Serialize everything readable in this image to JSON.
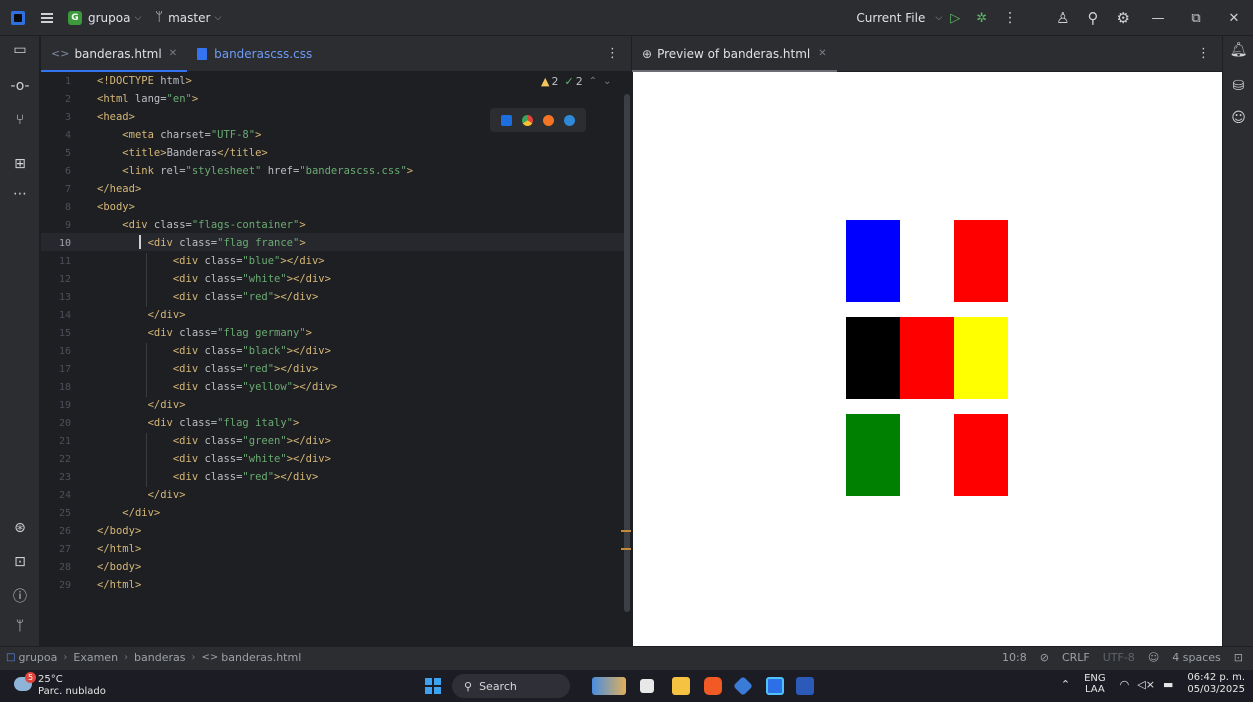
{
  "titlebar": {
    "project_badge": "G",
    "project_name": "grupoa",
    "branch_name": "master",
    "run_config": "Current File"
  },
  "editor_tabs": [
    {
      "label": "banderas.html",
      "active": true
    },
    {
      "label": "banderascss.css",
      "active": false
    }
  ],
  "editor": {
    "warnings_count": "2",
    "ok_count": "2",
    "current_line": "10",
    "lines": [
      {
        "num": "1",
        "text": "<!DOCTYPE html>"
      },
      {
        "num": "2",
        "text": "<html lang=\"en\">"
      },
      {
        "num": "3",
        "text": "<head>"
      },
      {
        "num": "4",
        "text": "    <meta charset=\"UTF-8\">"
      },
      {
        "num": "5",
        "text": "    <title>Banderas</title>"
      },
      {
        "num": "6",
        "text": "    <link rel=\"stylesheet\" href=\"banderascss.css\">"
      },
      {
        "num": "7",
        "text": "</head>"
      },
      {
        "num": "8",
        "text": "<body>"
      },
      {
        "num": "9",
        "text": "    <div class=\"flags-container\">"
      },
      {
        "num": "10",
        "text": "        <div class=\"flag france\">"
      },
      {
        "num": "11",
        "text": "            <div class=\"blue\"></div>"
      },
      {
        "num": "12",
        "text": "            <div class=\"white\"></div>"
      },
      {
        "num": "13",
        "text": "            <div class=\"red\"></div>"
      },
      {
        "num": "14",
        "text": "        </div>"
      },
      {
        "num": "15",
        "text": "        <div class=\"flag germany\">"
      },
      {
        "num": "16",
        "text": "            <div class=\"black\"></div>"
      },
      {
        "num": "17",
        "text": "            <div class=\"red\"></div>"
      },
      {
        "num": "18",
        "text": "            <div class=\"yellow\"></div>"
      },
      {
        "num": "19",
        "text": "        </div>"
      },
      {
        "num": "20",
        "text": "        <div class=\"flag italy\">"
      },
      {
        "num": "21",
        "text": "            <div class=\"green\"></div>"
      },
      {
        "num": "22",
        "text": "            <div class=\"white\"></div>"
      },
      {
        "num": "23",
        "text": "            <div class=\"red\"></div>"
      },
      {
        "num": "24",
        "text": "        </div>"
      },
      {
        "num": "25",
        "text": "    </div>"
      },
      {
        "num": "26",
        "text": "</body>"
      },
      {
        "num": "27",
        "text": "</html>"
      },
      {
        "num": "28",
        "text": "</body>"
      },
      {
        "num": "29",
        "text": "</html>"
      }
    ]
  },
  "preview": {
    "tab_label": "Preview of banderas.html",
    "flags": [
      {
        "name": "france",
        "stripes": [
          "#0000ff",
          "#ffffff",
          "#ff0000"
        ]
      },
      {
        "name": "germany",
        "stripes": [
          "#000000",
          "#ff0000",
          "#ffff00"
        ]
      },
      {
        "name": "italy",
        "stripes": [
          "#008000",
          "#ffffff",
          "#ff0000"
        ]
      }
    ]
  },
  "statusbar": {
    "breadcrumbs": [
      "grupoa",
      "Examen",
      "banderas",
      "banderas.html"
    ],
    "position": "10:8",
    "line_separator": "CRLF",
    "encoding": "UTF-8",
    "indent": "4 spaces"
  },
  "taskbar": {
    "weather_temp": "25°C",
    "weather_desc": "Parc. nublado",
    "weather_badge": "5",
    "search_placeholder": "Search",
    "lang_top": "ENG",
    "lang_bottom": "LAA",
    "time": "06:42 p. m.",
    "date": "05/03/2025"
  },
  "colors": {
    "accent": "#3574f0",
    "tag": "#d5b778",
    "string": "#6aab73",
    "editor_bg": "#1e1f22",
    "panel_bg": "#2b2d30"
  }
}
